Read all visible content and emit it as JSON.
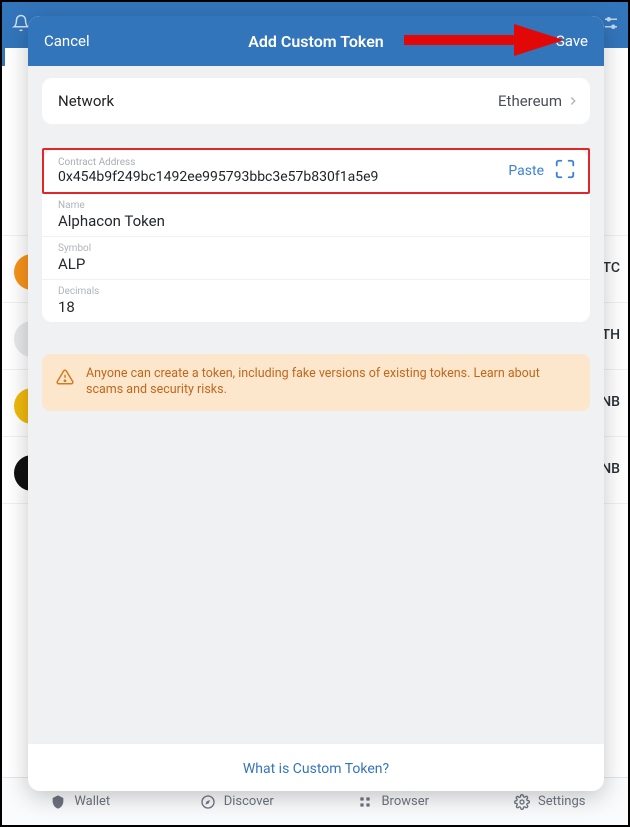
{
  "modal": {
    "cancel": "Cancel",
    "title": "Add Custom Token",
    "save": "Save"
  },
  "network": {
    "label": "Network",
    "value": "Ethereum"
  },
  "contract": {
    "label": "Contract Address",
    "value": "0x454b9f249bc1492ee995793bbc3e57b830f1a5e9",
    "paste": "Paste"
  },
  "name": {
    "label": "Name",
    "value": "Alphacon Token"
  },
  "symbol": {
    "label": "Symbol",
    "value": "ALP"
  },
  "decimals": {
    "label": "Decimals",
    "value": "18"
  },
  "warning": "Anyone can create a token, including fake versions of existing tokens. Learn about scams and security risks.",
  "footer": {
    "link": "What is Custom Token?"
  },
  "bg": {
    "tabs": {
      "wallet": "Wallet",
      "discover": "Discover",
      "browser": "Browser",
      "settings": "Settings"
    },
    "sym1": "TC",
    "sym2": "TH",
    "sym3": "NB",
    "sym4": "NB"
  }
}
